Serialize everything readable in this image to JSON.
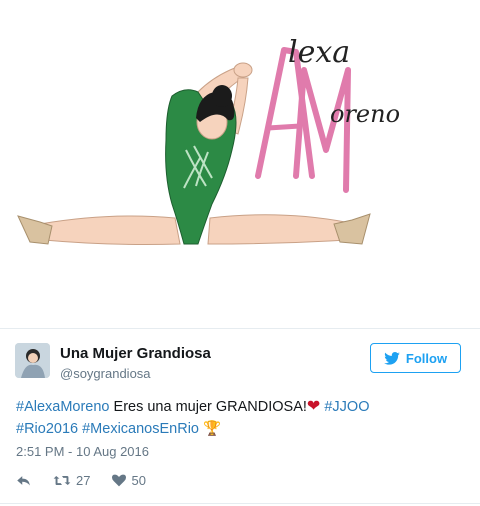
{
  "media": {
    "logo_first_name": "lexa",
    "logo_last_name": "oreno",
    "logo_initials": "AM",
    "alt": "Alexa Moreno"
  },
  "user": {
    "display_name": "Una Mujer Grandiosa",
    "handle": "@soygrandiosa"
  },
  "follow_button": {
    "label": "Follow"
  },
  "tweet": {
    "hashtag_1": "#AlexaMoreno",
    "text_1": " Eres una mujer GRANDIOSA!",
    "heart_emoji": "❤",
    "hashtag_2": "#JJOO",
    "hashtag_3": "#Rio2016",
    "hashtag_4": "#MexicanosEnRio",
    "trophy_emoji": "🏆",
    "timestamp": "2:51 PM - 10 Aug 2016"
  },
  "actions": {
    "retweet_count": "27",
    "like_count": "50"
  },
  "colors": {
    "link": "#2b7bb9",
    "follow": "#1da1f2",
    "muted": "#657786",
    "heart": "#c9132a",
    "leotard": "#2c8a45",
    "logo_pink": "#e07bac"
  },
  "icons": [
    "reply-icon",
    "retweet-icon",
    "heart-icon",
    "twitter-bird-icon"
  ]
}
